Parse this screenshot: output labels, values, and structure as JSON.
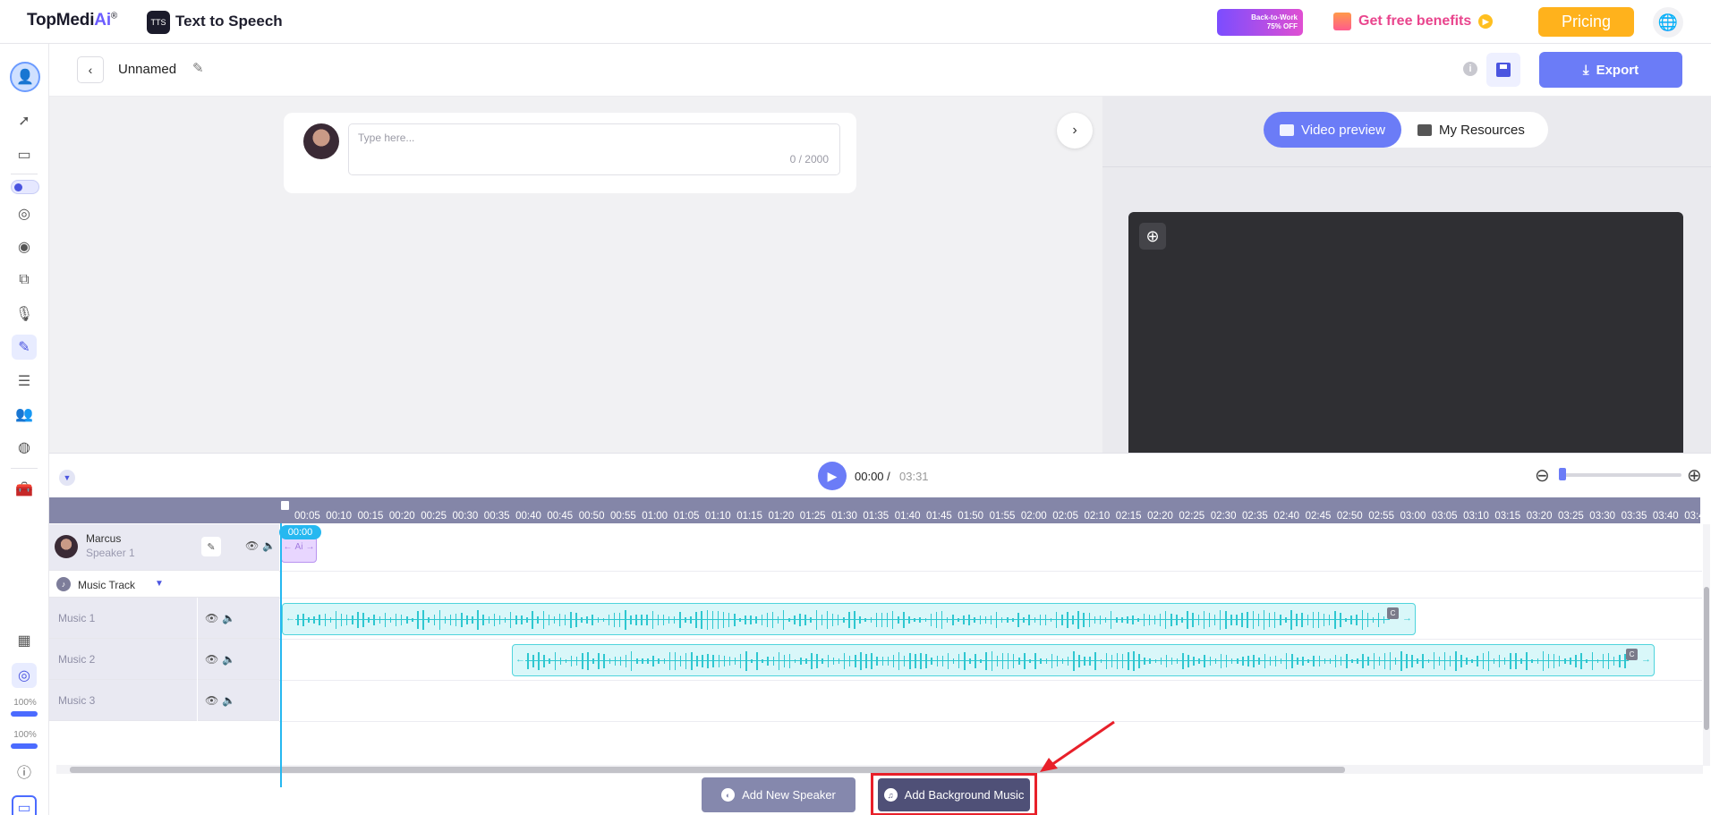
{
  "topbar": {
    "brand_main": "TopMedi",
    "brand_ai": "Ai",
    "brand_reg": "®",
    "app_badge": "TTS",
    "app_name": "Text to Speech",
    "promo_line1": "Back-to-Work",
    "promo_line2": "75% OFF",
    "benefits_label": "Get free benefits",
    "pricing_label": "Pricing",
    "globe_icon": "globe-icon"
  },
  "header": {
    "doc_name": "Unnamed",
    "export_label": "Export"
  },
  "editor": {
    "placeholder": "Type here...",
    "char_count": "0 / 2000"
  },
  "preview": {
    "tabs": [
      {
        "label": "Video preview",
        "active": true
      },
      {
        "label": "My Resources",
        "active": false
      }
    ]
  },
  "sidebar": {
    "zoom_pct_1": "100%",
    "zoom_pct_2": "100%"
  },
  "timeline": {
    "current_time": "00:00 /",
    "total_time": "03:31",
    "playhead_label": "00:00",
    "ruler_ticks": [
      "00:05",
      "00:10",
      "00:15",
      "00:20",
      "00:25",
      "00:30",
      "00:35",
      "00:40",
      "00:45",
      "00:50",
      "00:55",
      "01:00",
      "01:05",
      "01:10",
      "01:15",
      "01:20",
      "01:25",
      "01:30",
      "01:35",
      "01:40",
      "01:45",
      "01:50",
      "01:55",
      "02:00",
      "02:05",
      "02:10",
      "02:15",
      "02:20",
      "02:25",
      "02:30",
      "02:35",
      "02:40",
      "02:45",
      "02:50",
      "02:55",
      "03:00",
      "03:05",
      "03:10",
      "03:15",
      "03:20",
      "03:25",
      "03:30",
      "03:35",
      "03:40",
      "03:4"
    ],
    "speaker": {
      "name": "Marcus",
      "sub": "Speaker 1",
      "clip_text": "Ai"
    },
    "music_track_title": "Music Track",
    "music_rows": [
      {
        "name": "Music 1"
      },
      {
        "name": "Music 2"
      },
      {
        "name": "Music 3"
      }
    ],
    "add_speaker_label": "Add New Speaker",
    "add_music_label": "Add Background Music"
  },
  "colors": {
    "accent": "#6b7cf7",
    "pricing": "#ffb21c",
    "highlight": "#e8202a",
    "clip_music": "#2ec7d0",
    "clip_speaker": "#b893f0"
  }
}
